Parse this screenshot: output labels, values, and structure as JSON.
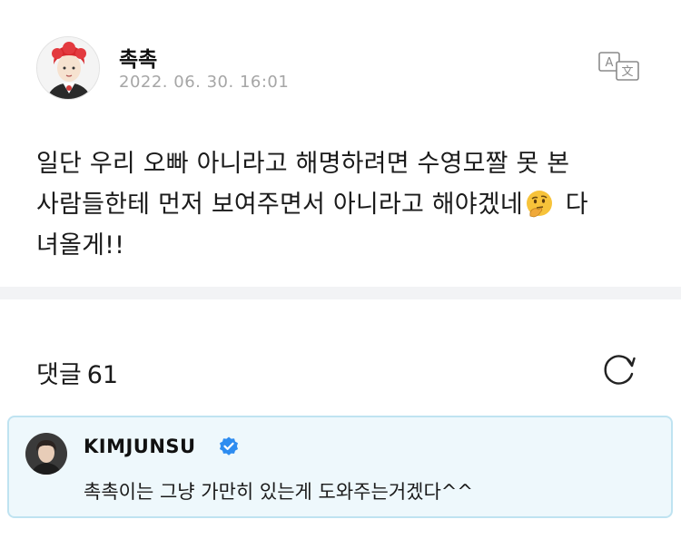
{
  "post": {
    "author": "촉촉",
    "timestamp": "2022. 06. 30. 16:01",
    "translate_icon": "translate-icon",
    "body_line1": "일단 우리 오빠 아니라고 해명하려면 수영모짤 못 본",
    "body_line2_before": "사람들한테 먼저 보여주면서 아니라고 해야겠네",
    "body_emoji": "thinking-face-emoji",
    "body_line2_after": " 다",
    "body_line3": "녀올게!!"
  },
  "comments": {
    "label": "댓글",
    "count": "61",
    "refresh_icon": "refresh-icon",
    "items": [
      {
        "author": "KIMJUNSU",
        "verified": true,
        "text": "촉촉이는 그냥 가만히 있는게 도와주는거겠다^^"
      }
    ]
  },
  "colors": {
    "timestamp": "#a6a6a6",
    "divider": "#f2f3f5",
    "comment_bg": "#eef8fc",
    "comment_border": "#bfe3f1",
    "verified": "#2d8cf0"
  }
}
